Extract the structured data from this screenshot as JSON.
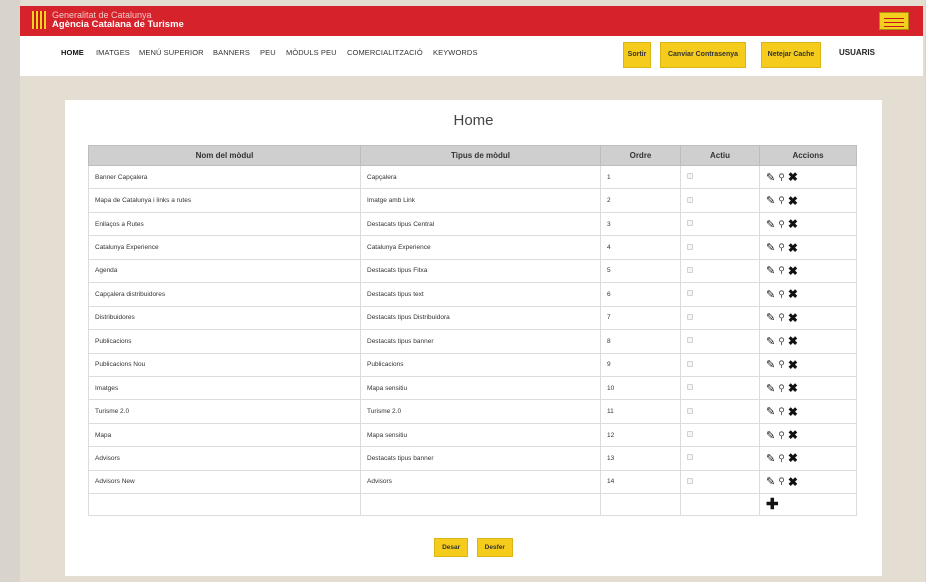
{
  "brand": {
    "line1": "Generalitat de Catalunya",
    "line2": "Agència Catalana de Turisme"
  },
  "nav": {
    "items": [
      {
        "label": "HOME",
        "active": true
      },
      {
        "label": "IMATGES",
        "active": false
      },
      {
        "label": "MENÚ SUPERIOR",
        "active": false
      },
      {
        "label": "BANNERS",
        "active": false
      },
      {
        "label": "PEU",
        "active": false
      },
      {
        "label": "MÒDULS PEU",
        "active": false
      },
      {
        "label": "COMERCIALITZACIÓ",
        "active": false
      },
      {
        "label": "KEYWORDS",
        "active": false
      }
    ],
    "sortir": "Sortir",
    "canviar": "Canviar Contrasenya",
    "netejar": "Netejar Cache",
    "users": "USUARIS"
  },
  "main": {
    "title": "Home",
    "columns": [
      "Nom del mòdul",
      "Tipus de mòdul",
      "Ordre",
      "Actiu",
      "Accions"
    ],
    "rows": [
      {
        "name": "Banner Capçalera",
        "type": "Capçalera",
        "order": "1"
      },
      {
        "name": "Mapa de Catalunya i links a rutes",
        "type": "Imatge amb Link",
        "order": "2"
      },
      {
        "name": "Enllaços a Rutes",
        "type": "Destacats tipus Central",
        "order": "3"
      },
      {
        "name": "Catalunya Experience",
        "type": "Catalunya Experience",
        "order": "4"
      },
      {
        "name": "Agenda",
        "type": "Destacats tipus Fitxa",
        "order": "5"
      },
      {
        "name": "Capçalera distribuidores",
        "type": "Destacats tipus text",
        "order": "6"
      },
      {
        "name": "Distribuidores",
        "type": "Destacats tipus Distribuidora",
        "order": "7"
      },
      {
        "name": "Publicacions",
        "type": "Destacats tipus banner",
        "order": "8"
      },
      {
        "name": "Publicacions Nou",
        "type": "Publicacions",
        "order": "9"
      },
      {
        "name": "Imatges",
        "type": "Mapa sensitiu",
        "order": "10"
      },
      {
        "name": "Turisme 2.0",
        "type": "Turisme 2.0",
        "order": "11"
      },
      {
        "name": "Mapa",
        "type": "Mapa sensitiu",
        "order": "12"
      },
      {
        "name": "Advisors",
        "type": "Destacats tipus banner",
        "order": "13"
      },
      {
        "name": "Advisors New",
        "type": "Advisors",
        "order": "14"
      }
    ],
    "row_icons": [
      "pencil-icon",
      "search-icon",
      "close-icon"
    ],
    "add_icon": "plus-icon",
    "save": "Desar",
    "undo": "Desfer"
  },
  "colors": {
    "brand_red": "#d6222a",
    "button_yellow": "#f5cc1c",
    "header_gray": "#cfcfcf"
  }
}
